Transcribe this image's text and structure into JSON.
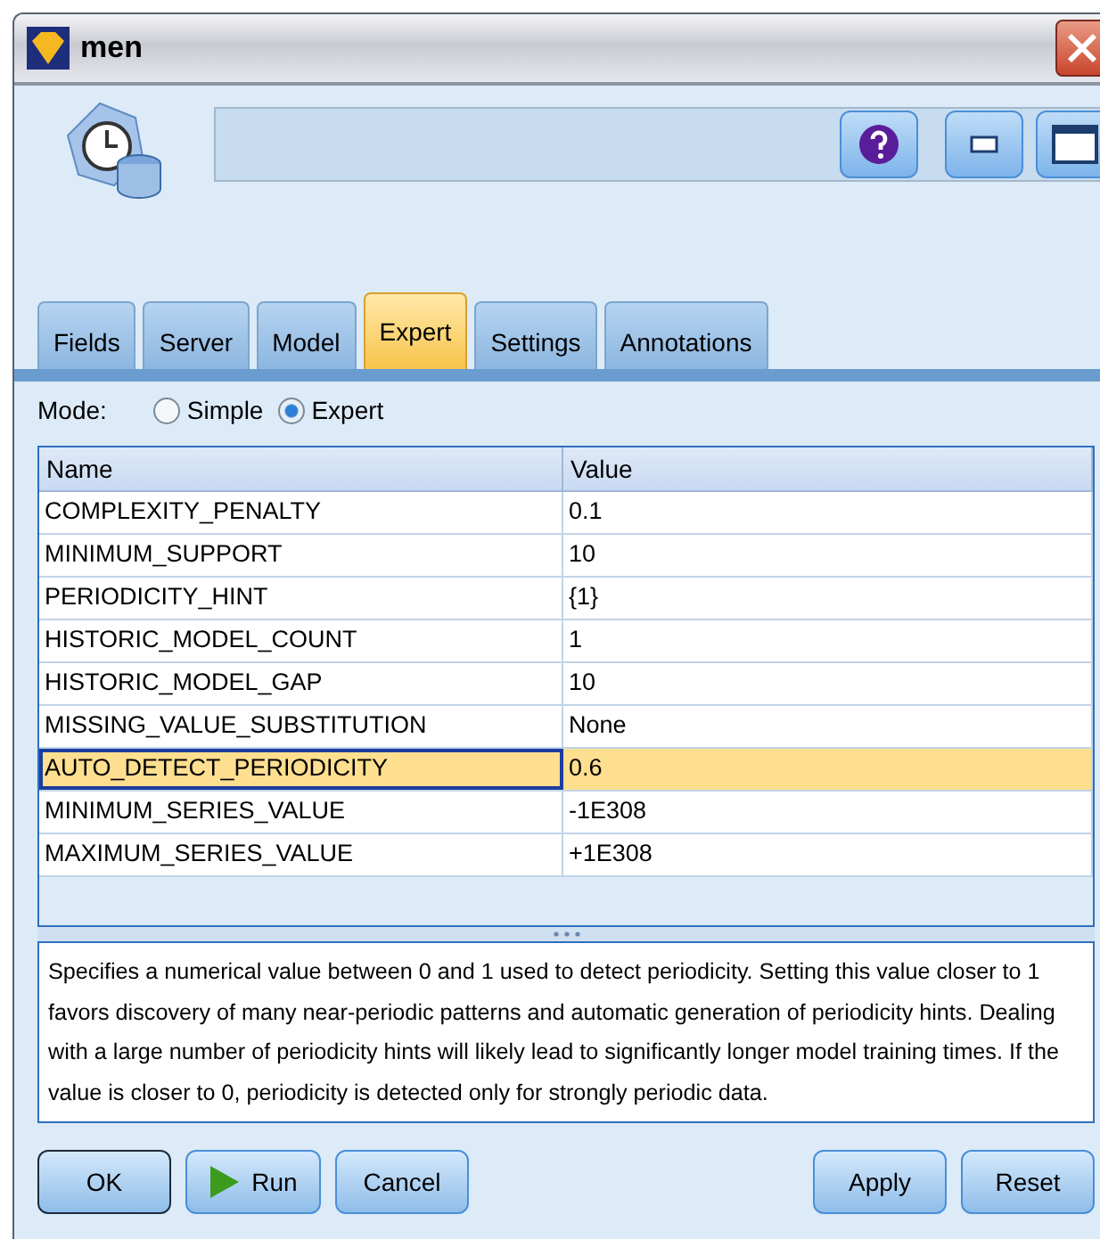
{
  "window": {
    "title": "men"
  },
  "tabs": [
    {
      "label": "Fields",
      "selected": false
    },
    {
      "label": "Server",
      "selected": false
    },
    {
      "label": "Model",
      "selected": false
    },
    {
      "label": "Expert",
      "selected": true
    },
    {
      "label": "Settings",
      "selected": false
    },
    {
      "label": "Annotations",
      "selected": false
    }
  ],
  "mode": {
    "label": "Mode:",
    "options": [
      {
        "label": "Simple",
        "selected": false
      },
      {
        "label": "Expert",
        "selected": true
      }
    ]
  },
  "table": {
    "columns": [
      "Name",
      "Value"
    ],
    "rows": [
      {
        "name": "COMPLEXITY_PENALTY",
        "value": "0.1",
        "selected": false
      },
      {
        "name": "MINIMUM_SUPPORT",
        "value": "10",
        "selected": false
      },
      {
        "name": "PERIODICITY_HINT",
        "value": "{1}",
        "selected": false
      },
      {
        "name": "HISTORIC_MODEL_COUNT",
        "value": "1",
        "selected": false
      },
      {
        "name": "HISTORIC_MODEL_GAP",
        "value": "10",
        "selected": false
      },
      {
        "name": "MISSING_VALUE_SUBSTITUTION",
        "value": "None",
        "selected": false
      },
      {
        "name": "AUTO_DETECT_PERIODICITY",
        "value": "0.6",
        "selected": true
      },
      {
        "name": "MINIMUM_SERIES_VALUE",
        "value": "-1E308",
        "selected": false
      },
      {
        "name": "MAXIMUM_SERIES_VALUE",
        "value": "+1E308",
        "selected": false
      }
    ]
  },
  "description": "Specifies a numerical value between 0 and 1 used to detect periodicity. Setting this value closer to 1 favors discovery of many near-periodic patterns and automatic generation of periodicity hints. Dealing with a large number of periodicity hints will likely lead to significantly longer model training times. If the value is closer to 0, periodicity is detected only for strongly periodic data.",
  "buttons_left": [
    {
      "label": "OK",
      "kind": "default"
    },
    {
      "label": "Run",
      "kind": "run"
    },
    {
      "label": "Cancel",
      "kind": "plain"
    }
  ],
  "buttons_right": [
    {
      "label": "Apply",
      "kind": "plain"
    },
    {
      "label": "Reset",
      "kind": "plain"
    }
  ]
}
